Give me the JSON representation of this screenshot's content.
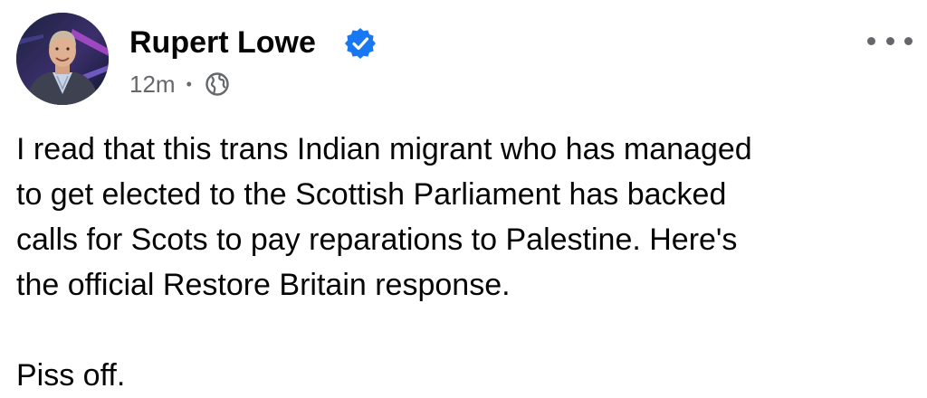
{
  "post": {
    "author": {
      "name": "Rupert Lowe",
      "verified": true
    },
    "timestamp": "12m",
    "separator": "•",
    "audience_icon": "globe-icon",
    "more_icon": "more-options-icon",
    "body": {
      "lines": [
        "I read that this trans Indian migrant who has managed",
        "to get elected to the Scottish Parliament has backed",
        "calls for Scots to pay reparations to Palestine. Here's",
        "the official Restore Britain response."
      ],
      "closing": "Piss off."
    }
  },
  "colors": {
    "text_primary": "#050505",
    "text_secondary": "#65676b",
    "verified_blue": "#1877f2",
    "background": "#ffffff"
  }
}
